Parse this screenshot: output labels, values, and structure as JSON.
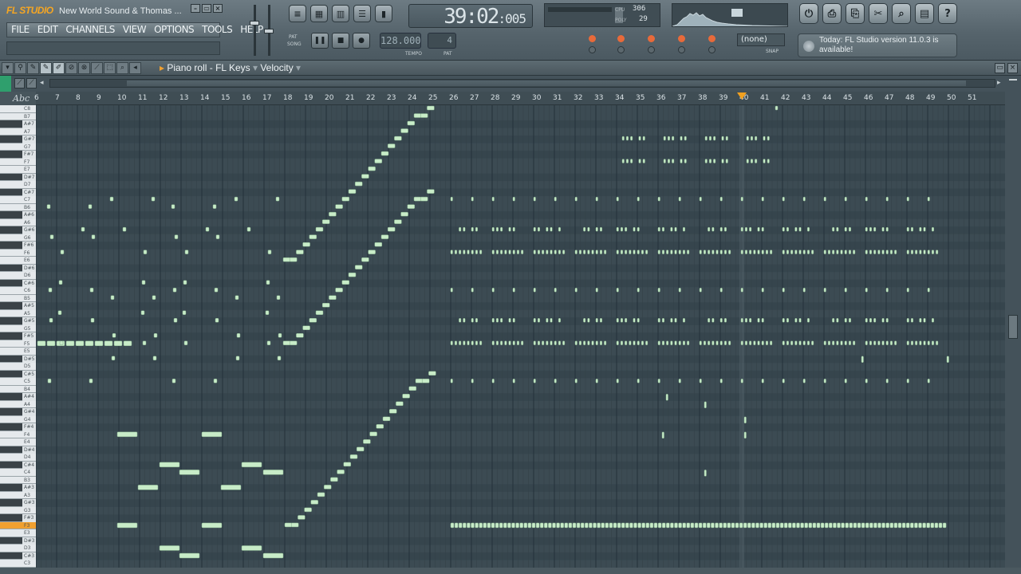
{
  "app": {
    "logo": "FL STUDIO",
    "song_title": "New World Sound & Thomas ...",
    "menu": [
      "FILE",
      "EDIT",
      "CHANNELS",
      "VIEW",
      "OPTIONS",
      "TOOLS",
      "HELP"
    ],
    "time_main": "39:02",
    "time_sub": ":005",
    "tempo": "128.000",
    "tempo_label": "TEMPO",
    "pattern": "4",
    "pattern_label": "PAT",
    "mode_labels": [
      "PAT",
      "SONG"
    ],
    "cpu": "306",
    "poly": "29",
    "cpu_label": "CPU",
    "poly_label": "POLY",
    "snap_select": "(none)",
    "snap_label": "SNAP",
    "news": "Today: FL Studio version 11.0.3 is available!",
    "colors": {
      "accent": "#f0a030",
      "note": "#c8e8c0",
      "grid_bg": "#3c4b53"
    }
  },
  "piano_roll": {
    "title": "Piano roll - FL Keys",
    "view_target": "Velocity",
    "ruler_label": "Abc",
    "ruler_numbers": [
      "6",
      "7",
      "8",
      "9",
      "10",
      "11",
      "12",
      "13",
      "14",
      "15",
      "16",
      "17",
      "18",
      "19",
      "20",
      "21",
      "22",
      "23",
      "24",
      "25",
      "26",
      "27",
      "28",
      "29",
      "30",
      "31",
      "32",
      "33",
      "34",
      "35",
      "36",
      "37",
      "38",
      "39",
      "40",
      "41",
      "42",
      "43",
      "44",
      "45",
      "46",
      "47",
      "48",
      "49",
      "50",
      "51"
    ],
    "keys": [
      "C8",
      "B7",
      "A#7",
      "A7",
      "G#7",
      "G7",
      "F#7",
      "F7",
      "E7",
      "D#7",
      "D7",
      "C#7",
      "C7",
      "B6",
      "A#6",
      "A6",
      "G#6",
      "G6",
      "F#6",
      "F6",
      "E6",
      "D#6",
      "D6",
      "C#6",
      "C6",
      "B5",
      "A#5",
      "A5",
      "G#5",
      "G5",
      "F#5",
      "F5",
      "E5",
      "D#5",
      "D5",
      "C#5",
      "C5",
      "B4",
      "A#4",
      "A4",
      "G#4",
      "G4",
      "F#4",
      "F4",
      "E4",
      "D#4",
      "D4",
      "C#4",
      "C4",
      "B3",
      "A#3",
      "A3",
      "G#3",
      "G3",
      "F#3",
      "F3",
      "E3",
      "D#3",
      "D3",
      "C#3",
      "C3"
    ],
    "highlighted_key": "F3",
    "tools": [
      "menu-icon",
      "pencil-icon",
      "paint-icon",
      "delete-icon",
      "mute-icon",
      "slice-icon",
      "select-icon",
      "zoom-icon",
      "play-icon"
    ]
  }
}
